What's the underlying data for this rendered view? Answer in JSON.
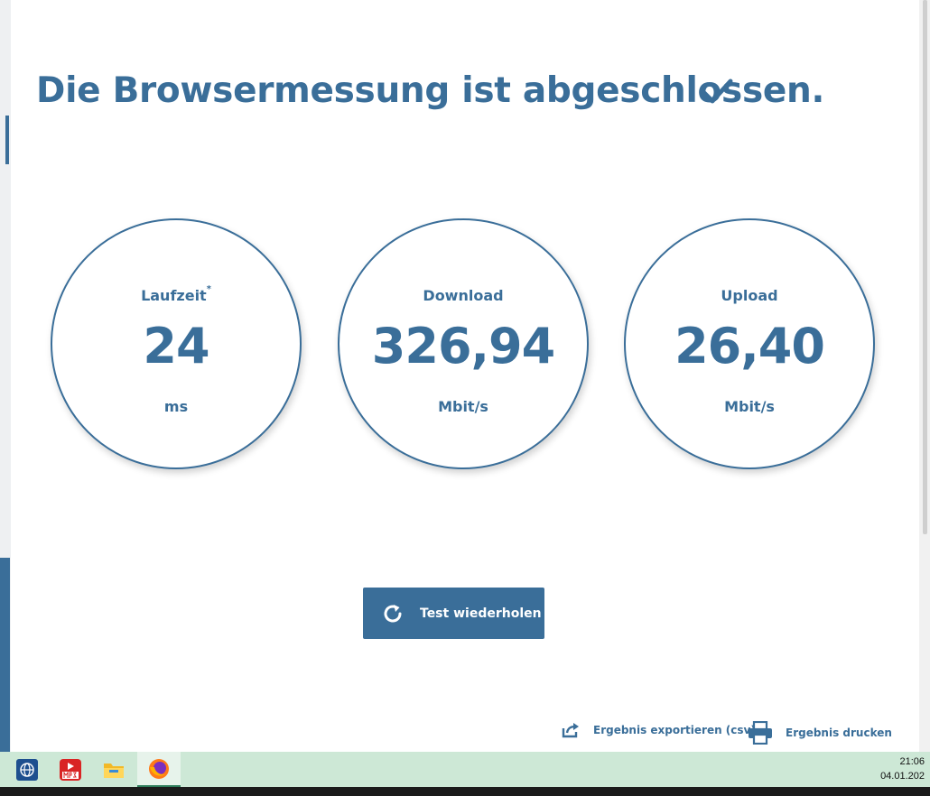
{
  "header": {
    "title": "Die Browsermessung ist abgeschlossen."
  },
  "icons": {
    "status": "check-icon",
    "repeat": "refresh-icon",
    "export": "share-export-icon",
    "print": "printer-icon"
  },
  "gauges": [
    {
      "label": "Laufzeit",
      "footnote": "*",
      "value": "24",
      "unit": "ms"
    },
    {
      "label": "Download",
      "value": "326,94",
      "unit": "Mbit/s"
    },
    {
      "label": "Upload",
      "value": "26,40",
      "unit": "Mbit/s"
    }
  ],
  "actions": {
    "repeat_label": "Test wiederholen",
    "export_label": "Ergebnis exportieren (csv)",
    "print_label": "Ergebnis drucken"
  },
  "taskbar": {
    "apps": [
      "network-globe-icon",
      "mp3-converter-icon",
      "file-explorer-icon",
      "firefox-icon"
    ],
    "time": "21:06",
    "date": "04.01.202"
  },
  "colors": {
    "brand": "#3a6e99",
    "taskbar": "#cde8d6"
  }
}
